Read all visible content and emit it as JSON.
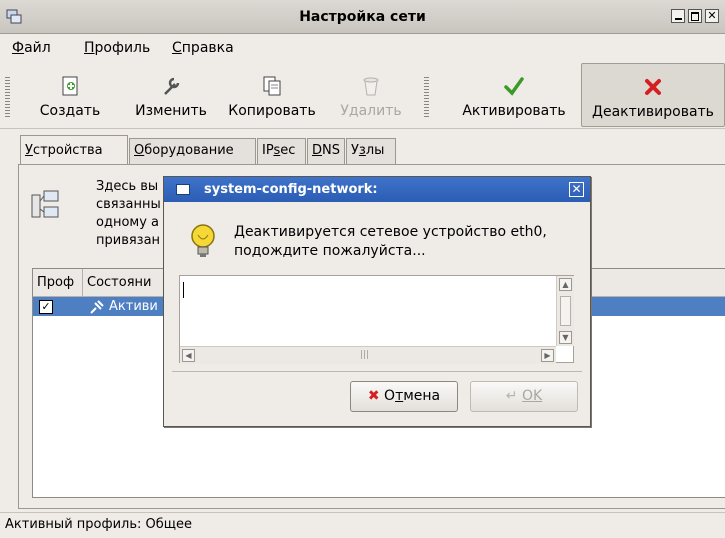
{
  "window": {
    "title": "Настройка сети"
  },
  "menu": {
    "file": {
      "accel": "Ф",
      "rest": "айл"
    },
    "profile": {
      "accel": "П",
      "rest": "рофиль"
    },
    "help": {
      "accel": "С",
      "rest": "правка"
    }
  },
  "toolbar": {
    "create": "Создать",
    "edit": "Изменить",
    "copy": "Копировать",
    "delete": "Удалить",
    "activate": "Активировать",
    "deactivate": "Деактивировать"
  },
  "tabs": {
    "devices": {
      "accel": "У",
      "rest": "стройства"
    },
    "hardware": {
      "accel": "О",
      "rest": "борудование"
    },
    "ipsec": {
      "pre": "IP",
      "accel": "s",
      "rest": "ec"
    },
    "dns": {
      "accel": "D",
      "rest": "NS"
    },
    "hosts": {
      "pre": "У",
      "accel": "з",
      "rest": "лы"
    }
  },
  "devices_panel": {
    "desc_line1": "Здесь вы",
    "desc_line2": "связанны",
    "desc_line3": "одному а",
    "desc_line4": "привязан",
    "col_profile": "Проф",
    "col_status": "Состояни",
    "row_status": "Активи",
    "row_checked": "✓"
  },
  "statusbar": {
    "text": "Активный профиль: Общее"
  },
  "dialog": {
    "title": "system-config-network:",
    "message_line1": "Деактивируется сетевое устройство eth0,",
    "message_line2": "подождите пожалуйста...",
    "textarea_value": "",
    "cancel": {
      "pre": "О",
      "accel": "т",
      "rest": "мена"
    },
    "ok": {
      "accel": "O",
      "rest": "K"
    }
  },
  "colors": {
    "dialog_title": "#3366c0",
    "selection": "#4e7fc2",
    "deactivate_icon": "#d42020",
    "activate_icon": "#3a9a2a"
  }
}
